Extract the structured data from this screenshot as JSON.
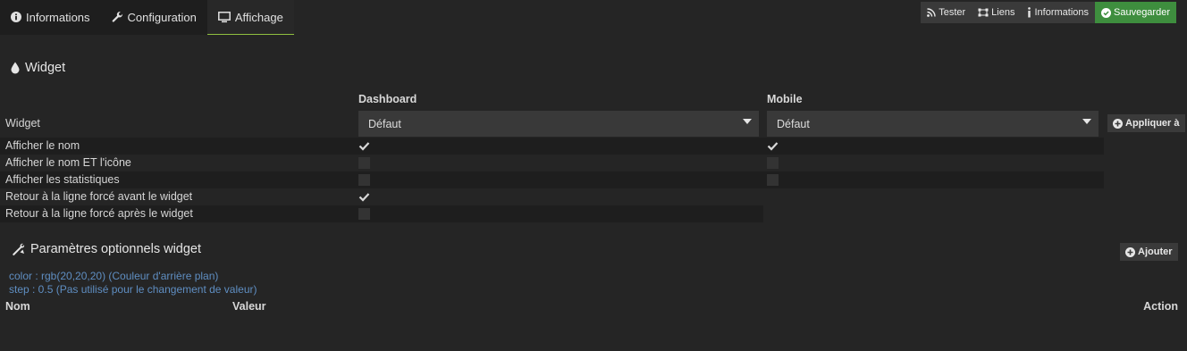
{
  "tabs": [
    {
      "label": "Informations",
      "icon": "info-circle-icon"
    },
    {
      "label": "Configuration",
      "icon": "wrench-icon"
    },
    {
      "label": "Affichage",
      "icon": "monitor-icon"
    }
  ],
  "toolbar": {
    "tester": "Tester",
    "liens": "Liens",
    "informations": "Informations",
    "sauvegarder": "Sauvegarder"
  },
  "widget_section": {
    "title": "Widget",
    "col_dashboard": "Dashboard",
    "col_mobile": "Mobile",
    "widget_label": "Widget",
    "dashboard_select": "Défaut",
    "mobile_select": "Défaut",
    "apply_button": "Appliquer à",
    "rows": [
      {
        "label": "Afficher le nom",
        "dashboard": true,
        "mobile": true
      },
      {
        "label": "Afficher le nom ET l'icône",
        "dashboard": false,
        "mobile": false
      },
      {
        "label": "Afficher les statistiques",
        "dashboard": false,
        "mobile": false
      },
      {
        "label": "Retour à la ligne forcé avant le widget",
        "dashboard": true
      },
      {
        "label": "Retour à la ligne forcé après le widget",
        "dashboard": false
      }
    ]
  },
  "optional_section": {
    "title": "Paramètres optionnels widget",
    "add_button": "Ajouter",
    "params": [
      "color : rgb(20,20,20) (Couleur d'arrière plan)",
      "step : 0.5 (Pas utilisé pour le changement de valeur)"
    ],
    "table_headers": {
      "nom": "Nom",
      "valeur": "Valeur",
      "action": "Action"
    }
  },
  "colors": {
    "background": "#252525",
    "accent_green": "#3e8e3e",
    "tab_active_underline": "#8fbf3f",
    "param_link": "#5f8ec2"
  }
}
